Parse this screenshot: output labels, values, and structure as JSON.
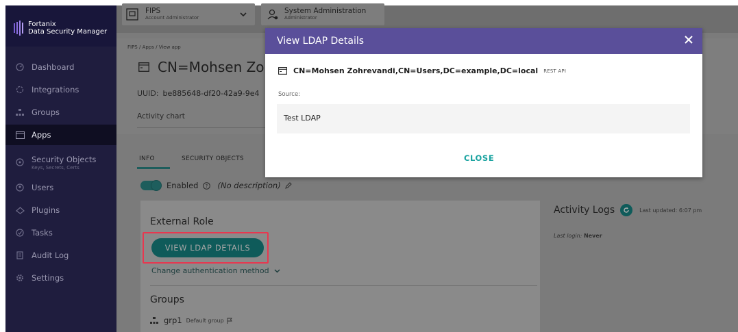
{
  "brand": {
    "line1": "Fortanix",
    "line2": "Data Security Manager"
  },
  "sidebar": {
    "items": [
      {
        "label": "Dashboard",
        "icon": "dashboard-icon"
      },
      {
        "label": "Integrations",
        "icon": "integrations-icon"
      },
      {
        "label": "Groups",
        "icon": "groups-icon"
      },
      {
        "label": "Apps",
        "icon": "apps-icon",
        "active": true
      },
      {
        "label": "Security Objects",
        "sub": "Keys, Secrets, Certs",
        "icon": "security-objects-icon"
      },
      {
        "label": "Users",
        "icon": "users-icon"
      },
      {
        "label": "Plugins",
        "icon": "plugins-icon"
      },
      {
        "label": "Tasks",
        "icon": "tasks-icon"
      },
      {
        "label": "Audit Log",
        "icon": "audit-log-icon"
      },
      {
        "label": "Settings",
        "icon": "settings-icon"
      }
    ]
  },
  "topbar": {
    "account": {
      "name": "FIPS",
      "role": "Account Administrator"
    },
    "system": {
      "name": "System Administration",
      "role": "Administrator"
    }
  },
  "page": {
    "breadcrumb": "FIPS / Apps / View app",
    "title": "CN=Mohsen Zohr",
    "uuid_label": "UUID:",
    "uuid_value": "be885648-df20-42a9-9e4",
    "activity_chart": "Activity chart",
    "tabs": [
      "INFO",
      "SECURITY OBJECTS"
    ],
    "enabled_label": "Enabled",
    "description": "(No description)",
    "external_role_title": "External Role",
    "view_ldap_button": "VIEW LDAP DETAILS",
    "change_auth": "Change authentication method",
    "groups_title": "Groups",
    "group_name": "grp1",
    "group_tag": "Default group"
  },
  "activity_logs": {
    "title": "Activity Logs",
    "last_updated": "Last updated: 6:07 pm",
    "last_login_label": "Last login:",
    "last_login_value": "Never"
  },
  "modal": {
    "title": "View LDAP Details",
    "dn": "CN=Mohsen Zohrevandi,CN=Users,DC=example,DC=local",
    "rest_api": "REST API",
    "source_label": "Source:",
    "source_value": "Test LDAP",
    "close_button": "CLOSE"
  },
  "colors": {
    "sidebar_bg": "#1f1d3e",
    "modal_header": "#5a4f9a",
    "accent_teal": "#1aa3a0",
    "highlight_red": "#e8374f"
  }
}
